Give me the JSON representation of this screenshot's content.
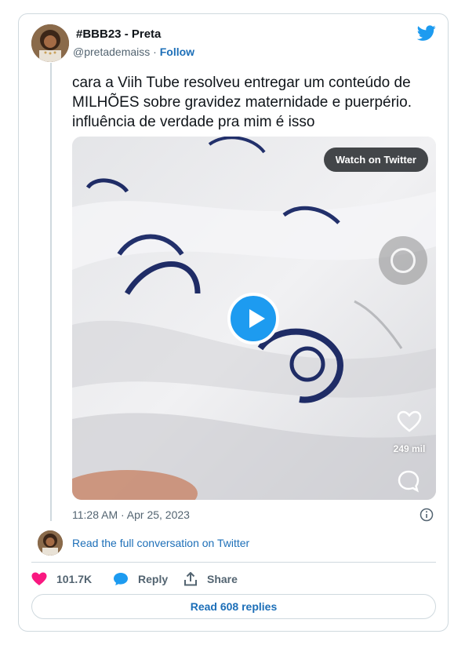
{
  "author": {
    "display_name": "#BBB23 - Preta",
    "handle": "@pretademaiss",
    "separator": "·",
    "follow_label": "Follow"
  },
  "tweet": {
    "text_lines": [
      "cara a Viih Tube resolveu entregar um conteúdo de",
      "MILHÕES sobre gravidez maternidade e puerpério.",
      "influência de verdade pra mim é isso"
    ],
    "timestamp": "11:28 AM · Apr 25, 2023"
  },
  "media": {
    "watch_label": "Watch on Twitter",
    "overlay_likes": "249 mil"
  },
  "conversation": {
    "read_full_label": "Read the full conversation on Twitter"
  },
  "actions": {
    "likes_count": "101.7K",
    "reply_label": "Reply",
    "share_label": "Share"
  },
  "replies": {
    "read_replies_label": "Read 608 replies"
  },
  "colors": {
    "twitter_blue": "#1d9bf0",
    "link_blue": "#1d6fb8",
    "like_pink": "#f91880",
    "muted_text": "#536471",
    "border": "#cfd9de"
  },
  "icons": {
    "brand": "twitter-bird-icon",
    "info": "info-icon",
    "like": "heart-icon",
    "reply": "speech-bubble-icon",
    "share": "share-upload-icon",
    "play": "play-icon"
  }
}
